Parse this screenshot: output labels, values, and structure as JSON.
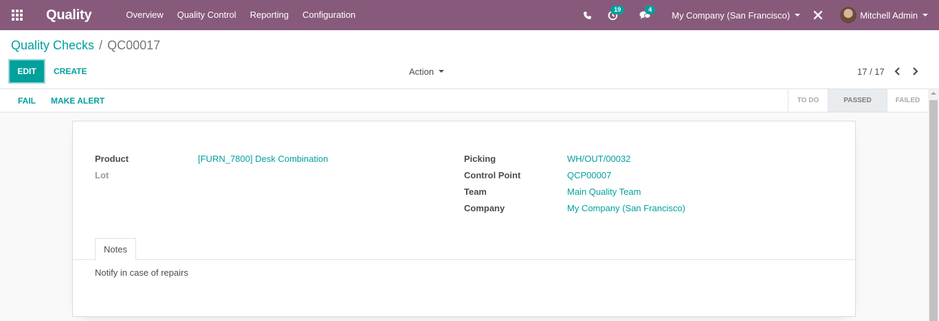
{
  "navbar": {
    "app_name": "Quality",
    "menu": [
      "Overview",
      "Quality Control",
      "Reporting",
      "Configuration"
    ],
    "activity_count": "19",
    "message_count": "4",
    "company": "My Company (San Francisco)",
    "user": "Mitchell Admin",
    "brand_color": "#875a7b"
  },
  "breadcrumb": {
    "parent": "Quality Checks",
    "separator": "/",
    "current": "QC00017"
  },
  "toolbar": {
    "edit_label": "EDIT",
    "create_label": "CREATE",
    "action_label": "Action",
    "pager": "17 / 17",
    "accent_color": "#00a09d"
  },
  "statusbar": {
    "fail_label": "FAIL",
    "alert_label": "MAKE ALERT",
    "stages": [
      "TO DO",
      "PASSED",
      "FAILED"
    ],
    "current_stage": "PASSED"
  },
  "form": {
    "product_label": "Product",
    "product_value": "[FURN_7800] Desk Combination",
    "lot_label": "Lot",
    "picking_label": "Picking",
    "picking_value": "WH/OUT/00032",
    "control_point_label": "Control Point",
    "control_point_value": "QCP00007",
    "team_label": "Team",
    "team_value": "Main Quality Team",
    "company_label": "Company",
    "company_value": "My Company (San Francisco)"
  },
  "notebook": {
    "tab_label": "Notes",
    "notes_text": "Notify in case of repairs"
  }
}
